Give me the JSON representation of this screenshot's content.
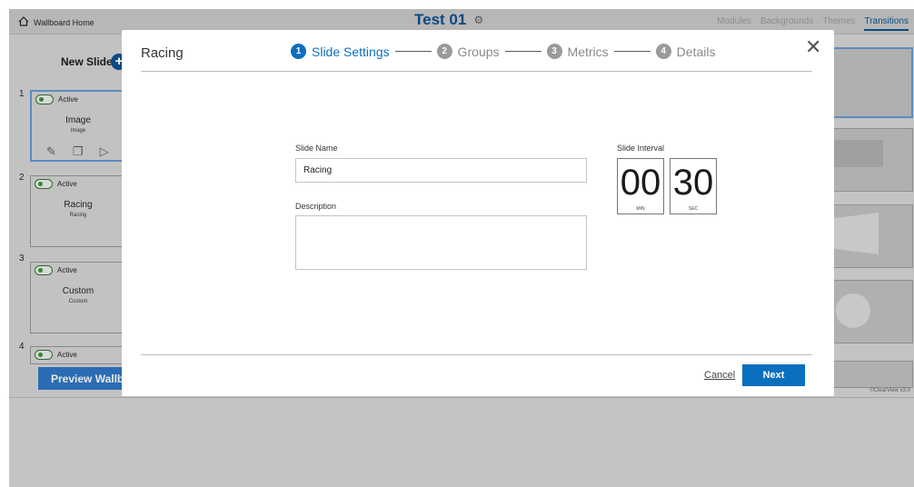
{
  "topbar": {
    "home_label": "Wallboard Home",
    "board_title": "Test 01",
    "nav": [
      "Modules",
      "Backgrounds",
      "Themes",
      "Transitions"
    ],
    "active_nav": "Transitions"
  },
  "sidebar": {
    "new_slide_label": "New Slide",
    "slides": [
      {
        "number": "1",
        "status": "Active",
        "title": "Image",
        "subtitle": "Image"
      },
      {
        "number": "2",
        "status": "Active",
        "title": "Racing",
        "subtitle": "Racing"
      },
      {
        "number": "3",
        "status": "Active",
        "title": "Custom",
        "subtitle": "Custom"
      },
      {
        "number": "4",
        "status": "Active"
      }
    ],
    "preview_label": "Preview Wallboard"
  },
  "footer": {
    "version": "©ClearView v3.0"
  },
  "modal": {
    "title": "Racing",
    "steps": [
      {
        "number": "1",
        "label": "Slide Settings"
      },
      {
        "number": "2",
        "label": "Groups"
      },
      {
        "number": "3",
        "label": "Metrics"
      },
      {
        "number": "4",
        "label": "Details"
      }
    ],
    "active_step": 1,
    "close_icon": "close-icon",
    "form": {
      "slide_name_label": "Slide Name",
      "slide_name_value": "Racing",
      "description_label": "Description",
      "description_value": "",
      "interval_label": "Slide Interval",
      "interval_minutes": "00",
      "interval_minutes_unit": "MIN",
      "interval_seconds": "30",
      "interval_seconds_unit": "SEC"
    },
    "cancel_label": "Cancel",
    "next_label": "Next"
  },
  "colors": {
    "accent": "#0b6fbf",
    "title_blue": "#0b4a80",
    "overlay": "#c4c4c4"
  }
}
